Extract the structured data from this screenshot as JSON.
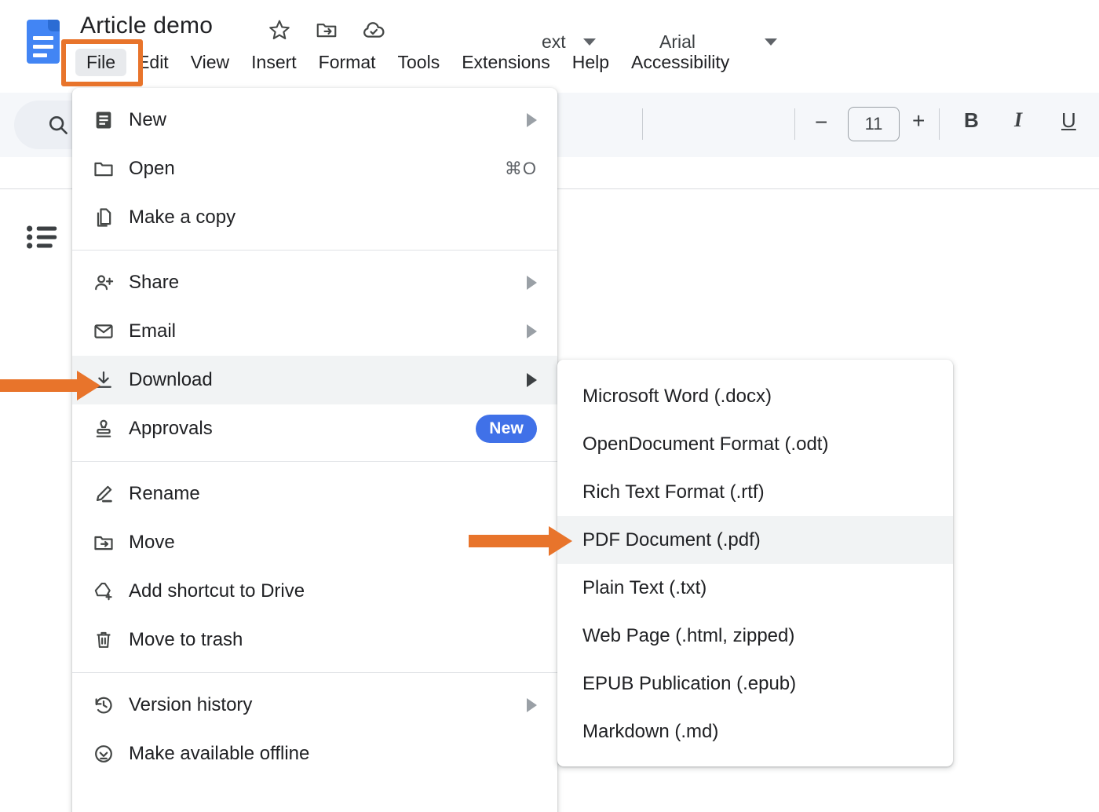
{
  "app": {
    "logo_icon": "google-docs-logo",
    "document_title": "Article demo"
  },
  "title_icons": [
    {
      "name": "star-icon",
      "label": "Star"
    },
    {
      "name": "move-to-folder-icon",
      "label": "Move"
    },
    {
      "name": "cloud-saved-icon",
      "label": "Saved to Drive"
    }
  ],
  "menubar": {
    "items": [
      {
        "label": "File",
        "active": true
      },
      {
        "label": "Edit",
        "active": false
      },
      {
        "label": "View",
        "active": false
      },
      {
        "label": "Insert",
        "active": false
      },
      {
        "label": "Format",
        "active": false
      },
      {
        "label": "Tools",
        "active": false
      },
      {
        "label": "Extensions",
        "active": false
      },
      {
        "label": "Help",
        "active": false
      },
      {
        "label": "Accessibility",
        "active": false
      }
    ]
  },
  "toolbar": {
    "search_icon": "search-icon",
    "outline_icon": "document-outline-icon",
    "style_value": "ext",
    "font_value": "Arial",
    "font_size_decrease": "−",
    "font_size_value": "11",
    "font_size_increase": "+",
    "bold_label": "B",
    "italic_label": "I",
    "underline_label": "U"
  },
  "file_menu": {
    "groups": [
      {
        "items": [
          {
            "label": "New",
            "icon": "new-document-icon",
            "submenu": true,
            "accel": "",
            "badge": "",
            "highlighted": false
          },
          {
            "label": "Open",
            "icon": "folder-icon",
            "submenu": false,
            "accel": "⌘O",
            "badge": "",
            "highlighted": false
          },
          {
            "label": "Make a copy",
            "icon": "copy-icon",
            "submenu": false,
            "accel": "",
            "badge": "",
            "highlighted": false
          }
        ]
      },
      {
        "items": [
          {
            "label": "Share",
            "icon": "person-add-icon",
            "submenu": true,
            "accel": "",
            "badge": "",
            "highlighted": false
          },
          {
            "label": "Email",
            "icon": "envelope-icon",
            "submenu": true,
            "accel": "",
            "badge": "",
            "highlighted": false
          },
          {
            "label": "Download",
            "icon": "download-icon",
            "submenu": true,
            "accel": "",
            "badge": "",
            "highlighted": true
          },
          {
            "label": "Approvals",
            "icon": "stamp-icon",
            "submenu": false,
            "accel": "",
            "badge": "New",
            "highlighted": false
          }
        ]
      },
      {
        "items": [
          {
            "label": "Rename",
            "icon": "pencil-icon",
            "submenu": false,
            "accel": "",
            "badge": "",
            "highlighted": false
          },
          {
            "label": "Move",
            "icon": "move-to-folder-icon",
            "submenu": false,
            "accel": "",
            "badge": "",
            "highlighted": false
          },
          {
            "label": "Add shortcut to Drive",
            "icon": "drive-shortcut-icon",
            "submenu": false,
            "accel": "",
            "badge": "",
            "highlighted": false
          },
          {
            "label": "Move to trash",
            "icon": "trash-icon",
            "submenu": false,
            "accel": "",
            "badge": "",
            "highlighted": false
          }
        ]
      },
      {
        "items": [
          {
            "label": "Version history",
            "icon": "history-icon",
            "submenu": true,
            "accel": "",
            "badge": "",
            "highlighted": false
          },
          {
            "label": "Make available offline",
            "icon": "offline-check-icon",
            "submenu": false,
            "accel": "",
            "badge": "",
            "highlighted": false
          }
        ]
      }
    ]
  },
  "download_submenu": {
    "items": [
      {
        "label": "Microsoft Word (.docx)",
        "highlighted": false
      },
      {
        "label": "OpenDocument Format (.odt)",
        "highlighted": false
      },
      {
        "label": "Rich Text Format (.rtf)",
        "highlighted": false
      },
      {
        "label": "PDF Document (.pdf)",
        "highlighted": true
      },
      {
        "label": "Plain Text (.txt)",
        "highlighted": false
      },
      {
        "label": "Web Page (.html, zipped)",
        "highlighted": false
      },
      {
        "label": "EPUB Publication (.epub)",
        "highlighted": false
      },
      {
        "label": "Markdown (.md)",
        "highlighted": false
      }
    ]
  },
  "annotations": {
    "highlight_color": "#E8742B",
    "badge_color": "#4071E8",
    "arrows": [
      {
        "name": "arrow-pointing-to-download",
        "target": "Download"
      },
      {
        "name": "arrow-pointing-to-pdf",
        "target": "PDF Document (.pdf)"
      }
    ]
  }
}
